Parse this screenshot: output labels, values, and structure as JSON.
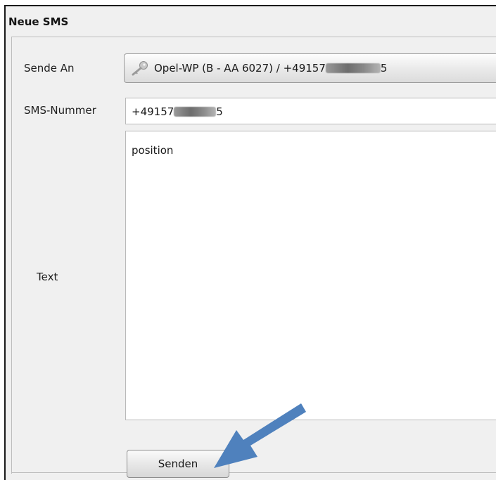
{
  "dialog": {
    "title": "Neue SMS"
  },
  "form": {
    "recipient_label": "Sende An",
    "recipient_value": "Opel-WP (B - AA 6027) / +49157",
    "recipient_suffix": "5",
    "number_label": "SMS-Nummer",
    "number_value": "+49157",
    "number_suffix": "5",
    "text_label": "Text",
    "text_value": "position",
    "send_label": "Senden"
  },
  "icons": {
    "recipient": "key-icon",
    "pointer": "arrow-annotation"
  },
  "colors": {
    "arrow": "#4f81bd",
    "frame": "#1a1a1a",
    "background": "#f0f0f0"
  }
}
